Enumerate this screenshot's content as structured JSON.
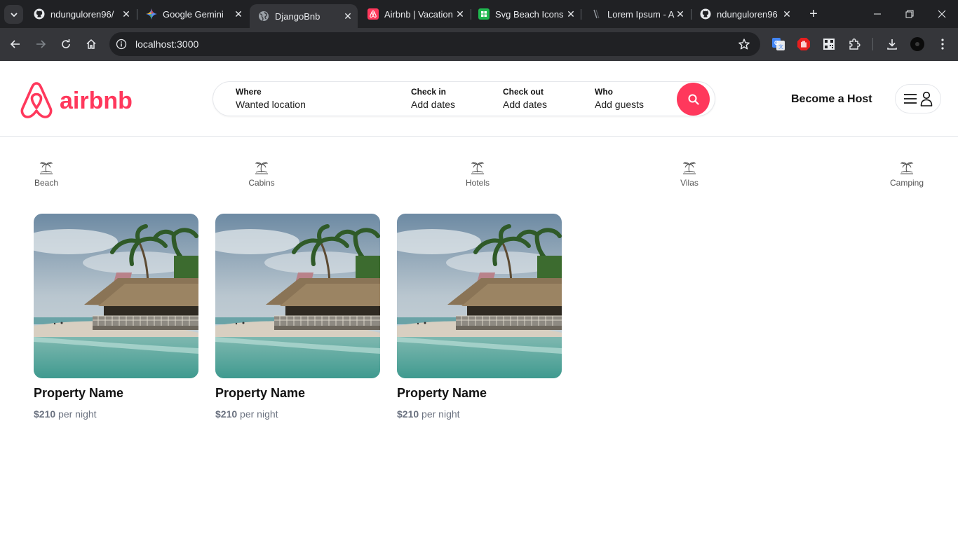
{
  "browser": {
    "tabs": [
      {
        "title": "ndunguloren96/",
        "icon": "github-icon",
        "active": false
      },
      {
        "title": "Google Gemini",
        "icon": "gemini-icon",
        "active": false
      },
      {
        "title": "DjangoBnb",
        "icon": "globe-icon",
        "active": true
      },
      {
        "title": "Airbnb | Vacation",
        "icon": "airbnb-icon",
        "active": false
      },
      {
        "title": "Svg Beach Icons",
        "icon": "svgrepo-icon",
        "active": false
      },
      {
        "title": "Lorem Ipsum - A",
        "icon": "lorem-icon",
        "active": false
      },
      {
        "title": "ndunguloren96",
        "icon": "github-icon",
        "active": false
      }
    ],
    "url": "localhost:3000"
  },
  "header": {
    "logo_text": "airbnb",
    "search": {
      "where_label": "Where",
      "where_value": "Wanted location",
      "checkin_label": "Check in",
      "checkin_value": "Add dates",
      "checkout_label": "Check out",
      "checkout_value": "Add dates",
      "who_label": "Who",
      "who_value": "Add guests"
    },
    "become_host": "Become a Host"
  },
  "categories": [
    {
      "label": "Beach",
      "icon": "palm-icon"
    },
    {
      "label": "Cabins",
      "icon": "palm-icon"
    },
    {
      "label": "Hotels",
      "icon": "palm-icon"
    },
    {
      "label": "Vilas",
      "icon": "palm-icon"
    },
    {
      "label": "Camping",
      "icon": "palm-icon"
    }
  ],
  "properties": [
    {
      "name": "Property Name",
      "price": "$210",
      "unit": "per night"
    },
    {
      "name": "Property Name",
      "price": "$210",
      "unit": "per night"
    },
    {
      "name": "Property Name",
      "price": "$210",
      "unit": "per night"
    }
  ],
  "colors": {
    "brand": "#ff385c",
    "chrome_dark": "#202124",
    "chrome_mid": "#35363a"
  }
}
